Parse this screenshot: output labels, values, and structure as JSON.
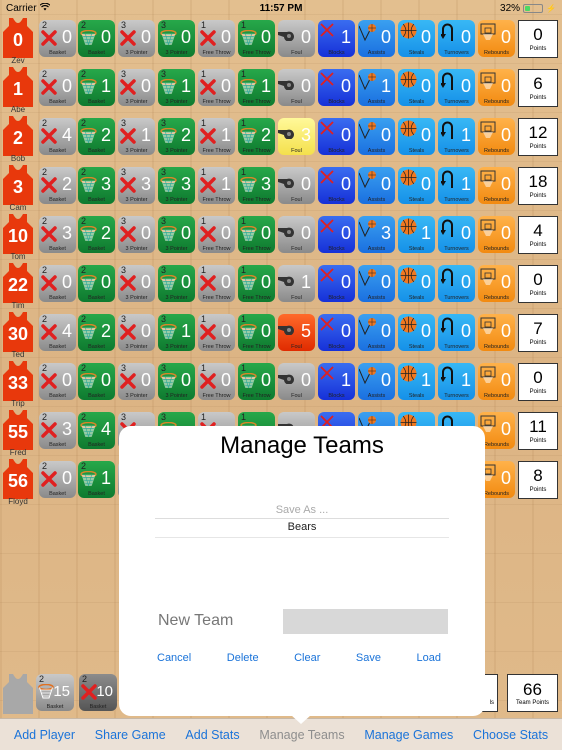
{
  "status_bar": {
    "carrier": "Carrier",
    "time": "11:57 PM",
    "battery_percent": "32%",
    "battery_level": 0.32
  },
  "stat_labels": {
    "basket_miss": "Basket",
    "basket_make": "Basket",
    "three_miss": "3 Pointer",
    "three_make": "3 Pointer",
    "ft_miss": "Free Throw",
    "ft_make": "Free Throw",
    "foul": "Foul",
    "blocks": "Blocks",
    "assists": "Assists",
    "steals": "Steals",
    "turnovers": "Turnovers",
    "rebounds": "Rebounds",
    "points": "Points"
  },
  "point_values": {
    "basket": "2",
    "three": "3",
    "ft": "1"
  },
  "players": [
    {
      "number": "0",
      "name_below": "Zev",
      "basket_miss": "0",
      "basket_make": "0",
      "three_miss": "0",
      "three_make": "0",
      "ft_miss": "0",
      "ft_make": "0",
      "foul": "0",
      "foul_state": "normal",
      "blocks": "1",
      "assists": "0",
      "steals": "0",
      "turnovers": "0",
      "rebounds": "0",
      "points": "0"
    },
    {
      "number": "1",
      "name_below": "Abe",
      "basket_miss": "0",
      "basket_make": "1",
      "three_miss": "0",
      "three_make": "1",
      "ft_miss": "0",
      "ft_make": "1",
      "foul": "0",
      "foul_state": "normal",
      "blocks": "0",
      "assists": "1",
      "steals": "0",
      "turnovers": "0",
      "rebounds": "0",
      "points": "6"
    },
    {
      "number": "2",
      "name_below": "Bob",
      "basket_miss": "4",
      "basket_make": "2",
      "three_miss": "1",
      "three_make": "2",
      "ft_miss": "1",
      "ft_make": "2",
      "foul": "3",
      "foul_state": "warning",
      "blocks": "0",
      "assists": "0",
      "steals": "0",
      "turnovers": "1",
      "rebounds": "0",
      "points": "12"
    },
    {
      "number": "3",
      "name_below": "Cam",
      "basket_miss": "2",
      "basket_make": "3",
      "three_miss": "3",
      "three_make": "3",
      "ft_miss": "1",
      "ft_make": "3",
      "foul": "0",
      "foul_state": "normal",
      "blocks": "0",
      "assists": "0",
      "steals": "0",
      "turnovers": "1",
      "rebounds": "0",
      "points": "18"
    },
    {
      "number": "10",
      "name_below": "Tom",
      "basket_miss": "3",
      "basket_make": "2",
      "three_miss": "0",
      "three_make": "0",
      "ft_miss": "0",
      "ft_make": "0",
      "foul": "0",
      "foul_state": "normal",
      "blocks": "0",
      "assists": "3",
      "steals": "1",
      "turnovers": "0",
      "rebounds": "0",
      "points": "4"
    },
    {
      "number": "22",
      "name_below": "Tim",
      "basket_miss": "0",
      "basket_make": "0",
      "three_miss": "0",
      "three_make": "0",
      "ft_miss": "0",
      "ft_make": "0",
      "foul": "1",
      "foul_state": "normal",
      "blocks": "0",
      "assists": "0",
      "steals": "0",
      "turnovers": "0",
      "rebounds": "0",
      "points": "0"
    },
    {
      "number": "30",
      "name_below": "Ted",
      "basket_miss": "4",
      "basket_make": "2",
      "three_miss": "0",
      "three_make": "1",
      "ft_miss": "0",
      "ft_make": "0",
      "foul": "5",
      "foul_state": "fouled_out",
      "blocks": "0",
      "assists": "0",
      "steals": "0",
      "turnovers": "0",
      "rebounds": "0",
      "points": "7"
    },
    {
      "number": "33",
      "name_below": "Trip",
      "basket_miss": "0",
      "basket_make": "0",
      "three_miss": "0",
      "three_make": "0",
      "ft_miss": "0",
      "ft_make": "0",
      "foul": "0",
      "foul_state": "normal",
      "blocks": "1",
      "assists": "0",
      "steals": "1",
      "turnovers": "1",
      "rebounds": "0",
      "points": "0"
    },
    {
      "number": "55",
      "name_below": "Fred",
      "basket_miss": "3",
      "basket_make": "4",
      "three_miss": "",
      "three_make": "",
      "ft_miss": "",
      "ft_make": "",
      "foul": "",
      "foul_state": "normal",
      "blocks": "",
      "assists": "",
      "steals": "",
      "turnovers": "",
      "rebounds": "0",
      "points": "11"
    },
    {
      "number": "56",
      "name_below": "Floyd",
      "basket_miss": "0",
      "basket_make": "1",
      "three_miss": "",
      "three_make": "",
      "ft_miss": "",
      "ft_make": "",
      "foul": "",
      "foul_state": "normal",
      "blocks": "",
      "assists": "",
      "steals": "",
      "turnovers": "",
      "rebounds": "0",
      "points": "8"
    }
  ],
  "totals": {
    "basket_make": "15",
    "basket_miss": "10",
    "label": "Basket",
    "team_points": "66",
    "team_points_label": "Team Points",
    "partial_box_label": "ls"
  },
  "toolbar": {
    "items": [
      {
        "label": "Add Player"
      },
      {
        "label": "Share Game"
      },
      {
        "label": "Add Stats"
      },
      {
        "label": "Manage Teams"
      },
      {
        "label": "Manage Games"
      },
      {
        "label": "Choose Stats"
      }
    ],
    "active_index": 3
  },
  "popover": {
    "title": "Manage Teams",
    "picker_placeholder": "Save As ...",
    "picker_selected": "Bears",
    "new_team_label": "New Team",
    "new_team_value": "",
    "actions": [
      "Cancel",
      "Delete",
      "Clear",
      "Save",
      "Load"
    ]
  },
  "colors": {
    "accent_blue": "#1a73d9",
    "jersey_red": "#e8380c",
    "tile_green": "#1a8f3c",
    "tile_gray": "#a0a0a0",
    "foul_warning": "#f4e04c",
    "foul_out": "#e02b00"
  }
}
